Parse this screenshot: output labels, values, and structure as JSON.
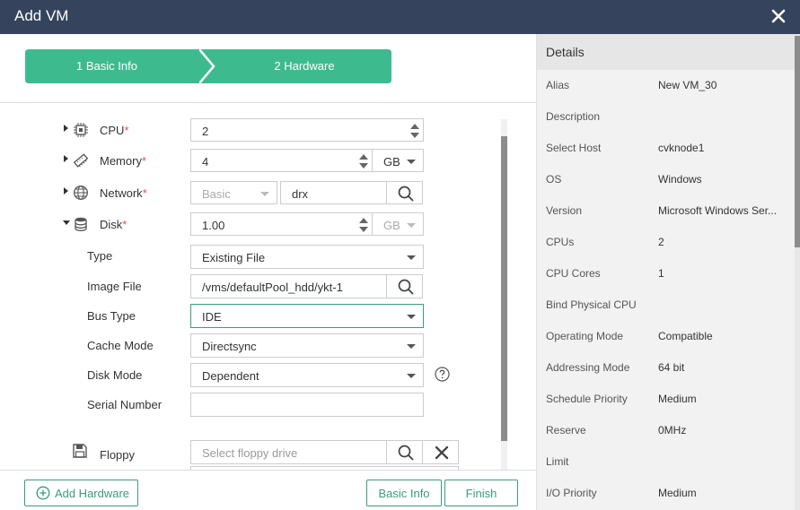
{
  "window": {
    "title": "Add VM"
  },
  "steps": [
    {
      "label": "1 Basic Info"
    },
    {
      "label": "2 Hardware"
    }
  ],
  "colors": {
    "accent": "#3dbb8f",
    "titlebar": "#35445c",
    "required": "#d9534f"
  },
  "form": {
    "cpu": {
      "label": "CPU",
      "required": "*",
      "value": "2",
      "icon": "cpu-icon"
    },
    "memory": {
      "label": "Memory",
      "required": "*",
      "value": "4",
      "unit": "GB",
      "icon": "memory-icon"
    },
    "network": {
      "label": "Network",
      "required": "*",
      "mode": "Basic",
      "value": "drx",
      "icon": "globe-icon"
    },
    "disk": {
      "label": "Disk",
      "required": "*",
      "value": "1.00",
      "unit": "GB",
      "icon": "database-icon",
      "type": {
        "label": "Type",
        "value": "Existing File"
      },
      "image_file": {
        "label": "Image File",
        "value": "/vms/defaultPool_hdd/ykt-1"
      },
      "bus_type": {
        "label": "Bus Type",
        "value": "IDE"
      },
      "cache_mode": {
        "label": "Cache Mode",
        "value": "Directsync"
      },
      "disk_mode": {
        "label": "Disk Mode",
        "value": "Dependent"
      },
      "serial_number": {
        "label": "Serial Number",
        "value": ""
      }
    },
    "floppy": {
      "label": "Floppy",
      "placeholder": "Select floppy drive",
      "icon": "floppy-icon"
    }
  },
  "footer": {
    "add_hardware": "Add Hardware",
    "basic_info": "Basic Info",
    "finish": "Finish"
  },
  "details": {
    "header": "Details",
    "rows": [
      {
        "key": "Alias",
        "value": "New VM_30"
      },
      {
        "key": "Description",
        "value": ""
      },
      {
        "key": "Select Host",
        "value": "cvknode1"
      },
      {
        "key": "OS",
        "value": "Windows"
      },
      {
        "key": "Version",
        "value": "Microsoft Windows Ser..."
      },
      {
        "key": "CPUs",
        "value": "2"
      },
      {
        "key": "CPU Cores",
        "value": "1"
      },
      {
        "key": "Bind Physical CPU",
        "value": ""
      },
      {
        "key": "Operating Mode",
        "value": "Compatible"
      },
      {
        "key": "Addressing Mode",
        "value": "64 bit"
      },
      {
        "key": "Schedule Priority",
        "value": "Medium"
      },
      {
        "key": "Reserve",
        "value": "0MHz"
      },
      {
        "key": "Limit",
        "value": ""
      },
      {
        "key": "I/O Priority",
        "value": "Medium"
      }
    ]
  }
}
